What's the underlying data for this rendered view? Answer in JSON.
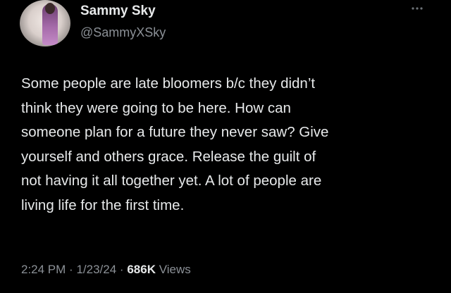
{
  "user": {
    "display_name": "Sammy Sky",
    "handle": "@SammyXSky",
    "avatar_icon": "profile-photo"
  },
  "more_icon": "ellipsis-icon",
  "tweet": {
    "lines": [
      "Some people are late bloomers b/c they didn’t",
      "think they were going to be here.  How can",
      "someone plan for a future they never saw? Give",
      "yourself and others grace. Release the guilt of",
      "not having it all together yet. A lot of people are",
      "living life for the first time."
    ]
  },
  "meta": {
    "time": "2:24 PM",
    "separator": "·",
    "date": "1/23/24",
    "views_count": "686K",
    "views_label": "Views"
  },
  "colors": {
    "background": "#000000",
    "primary_text": "#e7e9ea",
    "secondary_text": "#8b9096"
  }
}
